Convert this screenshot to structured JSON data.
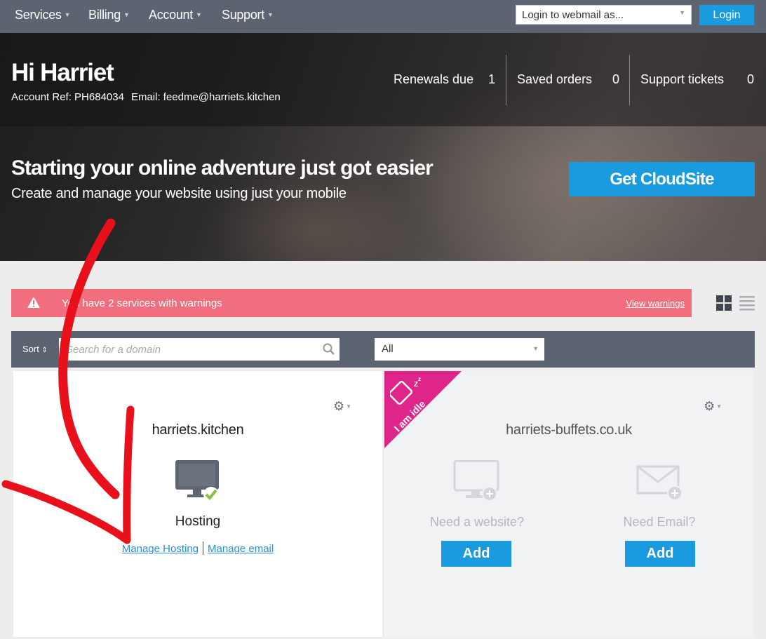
{
  "nav": {
    "items": [
      "Services",
      "Billing",
      "Account",
      "Support"
    ],
    "webmail_placeholder": "Login to webmail as...",
    "login_label": "Login"
  },
  "hero": {
    "greeting": "Hi Harriet",
    "account_ref": "Account Ref: PH684034",
    "email": "Email: feedme@harriets.kitchen",
    "stats": [
      {
        "label": "Renewals due",
        "value": "1"
      },
      {
        "label": "Saved orders",
        "value": "0"
      },
      {
        "label": "Support tickets",
        "value": "0"
      }
    ],
    "promo_title": "Starting your online adventure just got easier",
    "promo_sub": "Create and manage your website using just your mobile",
    "cta_label": "Get CloudSite"
  },
  "warning": {
    "text": "You have 2 services with warnings",
    "link": "View warnings"
  },
  "filter": {
    "sort_label": "Sort",
    "search_placeholder": "Search for a domain",
    "select_value": "All"
  },
  "cards": [
    {
      "domain": "harriets.kitchen",
      "service": "Hosting",
      "link1": "Manage Hosting",
      "link2": "Manage email"
    },
    {
      "domain": "harriets-buffets.co.uk",
      "ribbon": "I am idle",
      "need_website": "Need a website?",
      "need_email": "Need Email?",
      "add_label": "Add"
    }
  ],
  "colors": {
    "nav_bg": "#5b6470",
    "accent": "#1a9be0",
    "warning": "#f06e7d",
    "ribbon": "#e0258a",
    "annotation_arrow": "#e8111b"
  }
}
